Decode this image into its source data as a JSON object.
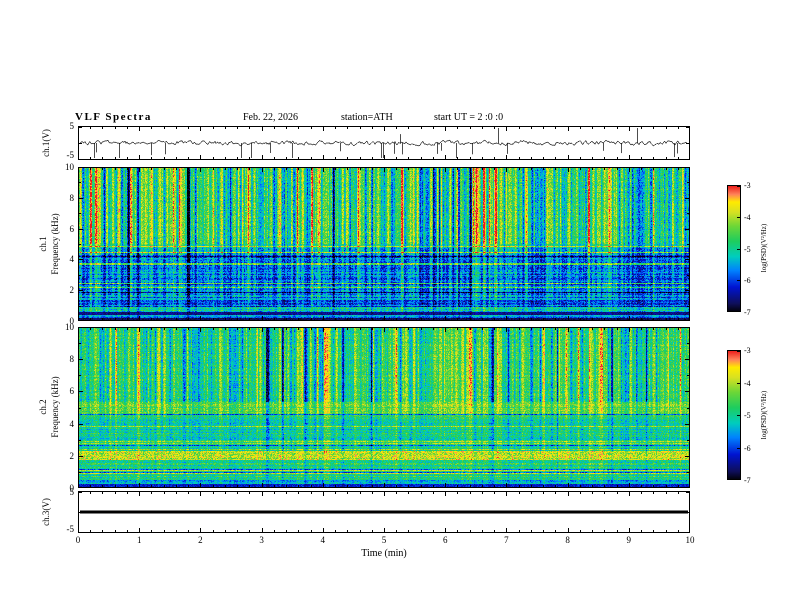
{
  "header": {
    "title": "VLF  Spectra",
    "date": "Feb. 22, 2026",
    "station": "station=ATH",
    "start_ut": "start UT =  2 :0 :0"
  },
  "x_axis": {
    "label": "Time  (min)",
    "ticks": [
      "0",
      "1",
      "2",
      "3",
      "4",
      "5",
      "6",
      "7",
      "8",
      "9",
      "10"
    ],
    "range": [
      0,
      10
    ]
  },
  "panels": {
    "ch1_wave": {
      "label": "ch.1(V)",
      "ytick_top": "5",
      "ytick_bottom": "-5",
      "yrange": [
        -5,
        5
      ]
    },
    "ch1_spec": {
      "label_line1": "ch.1",
      "label_line2": "Frequency  (kHz)",
      "yticks": [
        "10",
        "8",
        "6",
        "4",
        "2",
        "0"
      ],
      "yrange": [
        0,
        10
      ]
    },
    "ch2_spec": {
      "label_line1": "ch.2",
      "label_line2": "Frequency  (kHz)",
      "yticks": [
        "10",
        "8",
        "6",
        "4",
        "2",
        "0"
      ],
      "yrange": [
        0,
        10
      ]
    },
    "ch3_wave": {
      "label": "ch.3(V)",
      "ytick_top": "5",
      "ytick_bottom": "-5",
      "yrange": [
        -5,
        5
      ]
    }
  },
  "colorbar": {
    "label": "log(PSD)(V²/Hz)",
    "ticks": [
      "-3",
      "-4",
      "-5",
      "-6",
      "-7"
    ],
    "range": [
      -7,
      -3
    ],
    "colormap": [
      {
        "pos": 0.0,
        "hex": "#000000"
      },
      {
        "pos": 0.07,
        "hex": "#0f0f5a"
      },
      {
        "pos": 0.2,
        "hex": "#0014d2"
      },
      {
        "pos": 0.33,
        "hex": "#0082ff"
      },
      {
        "pos": 0.44,
        "hex": "#00cdbe"
      },
      {
        "pos": 0.56,
        "hex": "#1ecd5f"
      },
      {
        "pos": 0.68,
        "hex": "#6ed737"
      },
      {
        "pos": 0.79,
        "hex": "#d7e123"
      },
      {
        "pos": 0.87,
        "hex": "#ffeb00"
      },
      {
        "pos": 0.93,
        "hex": "#ff825a"
      },
      {
        "pos": 1.0,
        "hex": "#eb1919"
      }
    ]
  },
  "chart_data": [
    {
      "type": "line",
      "title": "ch.1 voltage waveform",
      "xlabel": "Time (min)",
      "ylabel": "ch.1(V)",
      "xlim": [
        0,
        10
      ],
      "ylim": [
        -5,
        5
      ],
      "yticks": [
        5,
        -5
      ],
      "description": "Broadband noisy voltage trace centered near 0 V across the full 0-10 min record, with many short impulsive spikes reaching roughly -4 V (downward) and a few upward spikes."
    },
    {
      "type": "heatmap",
      "title": "ch.1 VLF spectrogram",
      "xlabel": "Time (min)",
      "ylabel": "Frequency (kHz)",
      "xlim": [
        0,
        10
      ],
      "ylim": [
        0,
        10
      ],
      "yticks": [
        0,
        2,
        4,
        6,
        8,
        10
      ],
      "zlabel": "log(PSD)(V²/Hz)",
      "zlim": [
        -7,
        -3
      ],
      "description": "Green background (~-5) above ~5 kHz with dense vertical striations: bright yellow (~-4) burst columns and dark-blue (~-6.5) dropout columns. Blue band (~-6) with horizontal structure from ~1 to ~4.5 kHz. Thin dark/black rows (~-7) below ~0.5 kHz and at the very bottom edge."
    },
    {
      "type": "heatmap",
      "title": "ch.2 VLF spectrogram",
      "xlabel": "Time (min)",
      "ylabel": "Frequency (kHz)",
      "xlim": [
        0,
        10
      ],
      "ylim": [
        0,
        10
      ],
      "yticks": [
        0,
        2,
        4,
        6,
        8,
        10
      ],
      "zlabel": "log(PSD)(V²/Hz)",
      "zlim": [
        -7,
        -3
      ],
      "description": "Mostly uniform green/cyan (~-5) field. Weaker vertical striations above ~5 kHz, a brighter yellow-green band near 4.5-5 kHz, a strong yellow band (~-4) around 2 kHz with reddish specks, thin horizontal yellow-green lines below 2 kHz, and dark rows (~-7) near 0 kHz."
    },
    {
      "type": "line",
      "title": "ch.3 voltage waveform",
      "xlabel": "Time (min)",
      "ylabel": "ch.3(V)",
      "xlim": [
        0,
        10
      ],
      "ylim": [
        -5,
        5
      ],
      "yticks": [
        5,
        -5
      ],
      "description": "Flat thick black line at 0 V for the entire record (channel inactive)."
    }
  ]
}
